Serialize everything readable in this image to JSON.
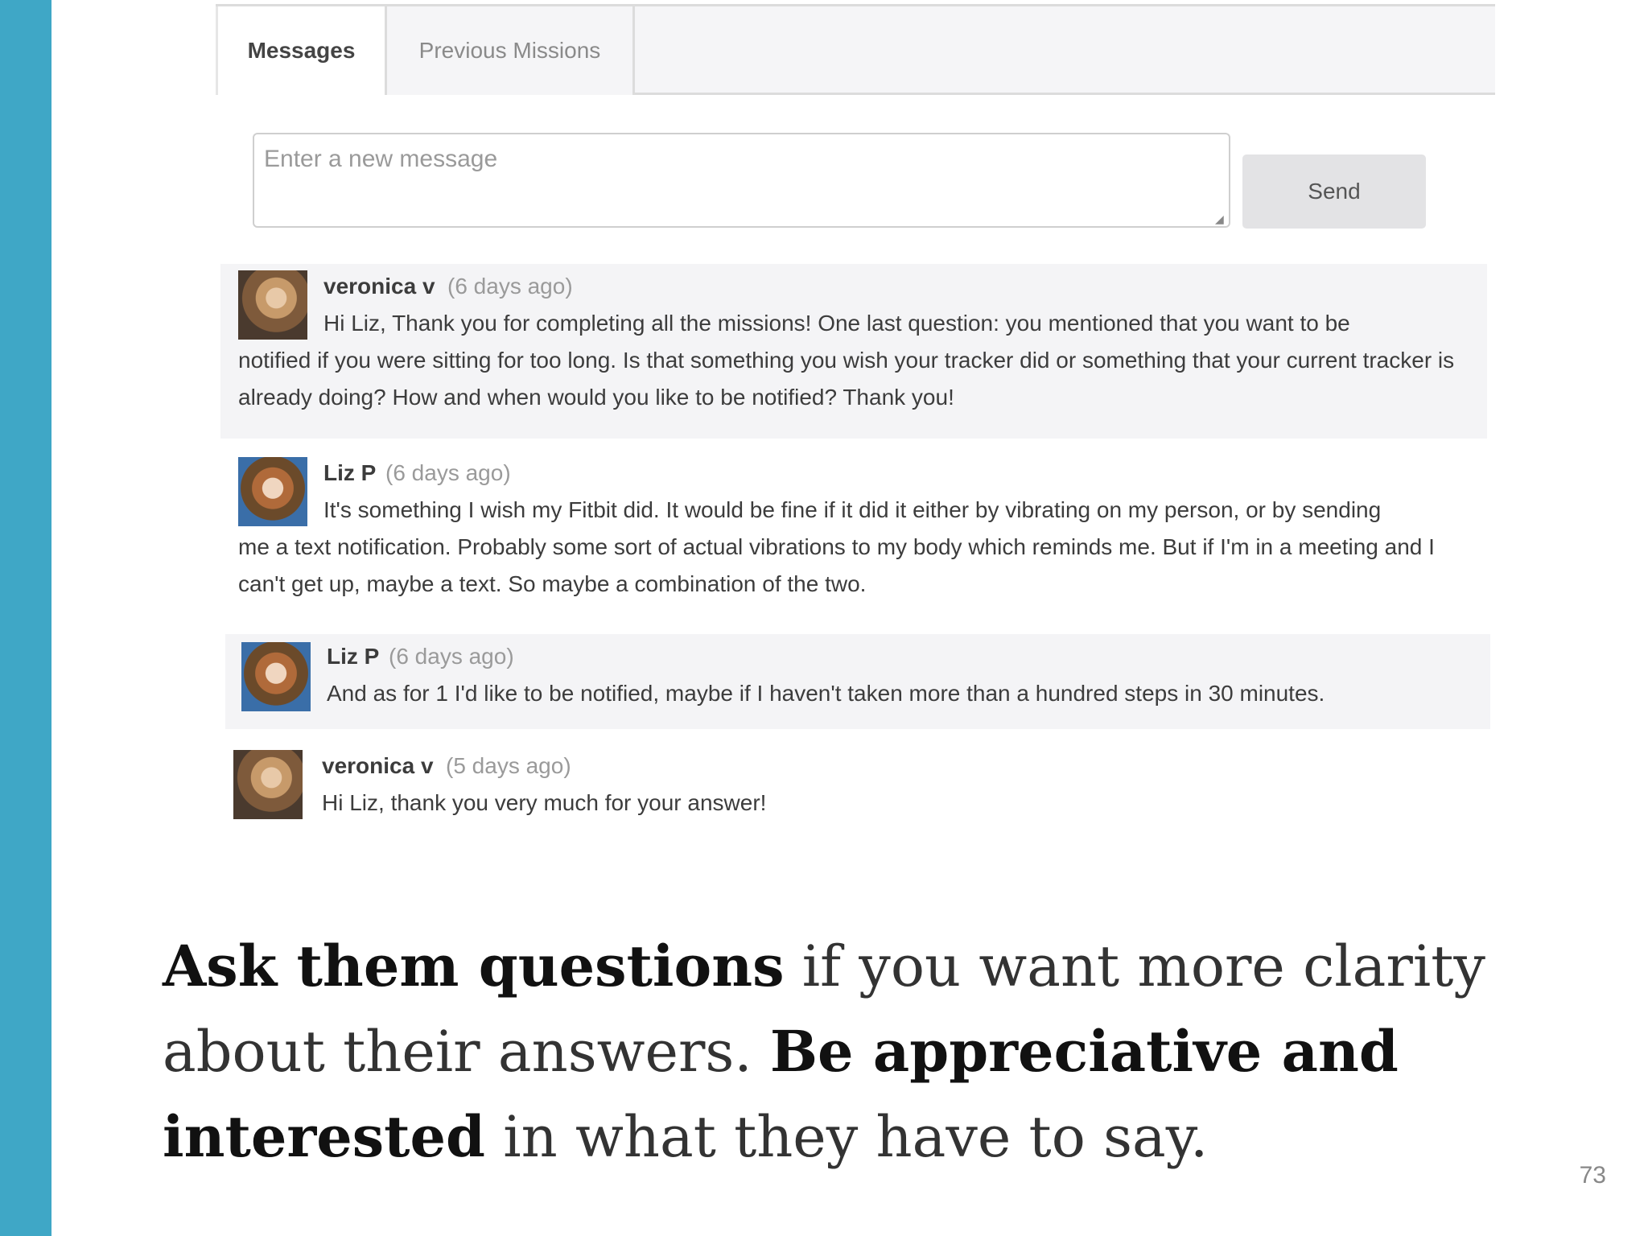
{
  "tabs": {
    "messages": "Messages",
    "previous_missions": "Previous Missions"
  },
  "composer": {
    "placeholder": "Enter a new message",
    "send_label": "Send"
  },
  "messages": [
    {
      "author": "veronica v",
      "time": "(6 days ago)",
      "text_first": "Hi Liz, Thank you for completing all the missions! One last question: you mentioned that you want to be",
      "text_rest": "notified if you were sitting for too long. Is that something you wish your tracker did or something that your current tracker is already doing? How and when would you like to be notified? Thank you!"
    },
    {
      "author": "Liz P",
      "time": "(6 days ago)",
      "text_first": "It's something I wish my Fitbit did. It would be fine if it did it either by vibrating on my person, or by sending",
      "text_rest": "me a text notification. Probably some sort of actual vibrations to my body which reminds me. But if I'm in a meeting and I can't get up, maybe a text. So maybe a combination of the two."
    },
    {
      "author": "Liz P",
      "time": "(6 days ago)",
      "text_first": "And as for 1 I'd like to be notified, maybe if I haven't taken more than a hundred steps in 30 minutes."
    },
    {
      "author": "veronica v",
      "time": "(5 days ago)",
      "text_first": "Hi Liz, thank you very much for your answer!"
    }
  ],
  "caption": {
    "part1_bold": "Ask them questions",
    "part2": " if you want more clarity about their answers. ",
    "part3_bold": "Be appreciative and interested",
    "part4": " in what they have to say."
  },
  "page_number": "73",
  "colors": {
    "accent_bar": "#3fa7c6"
  }
}
